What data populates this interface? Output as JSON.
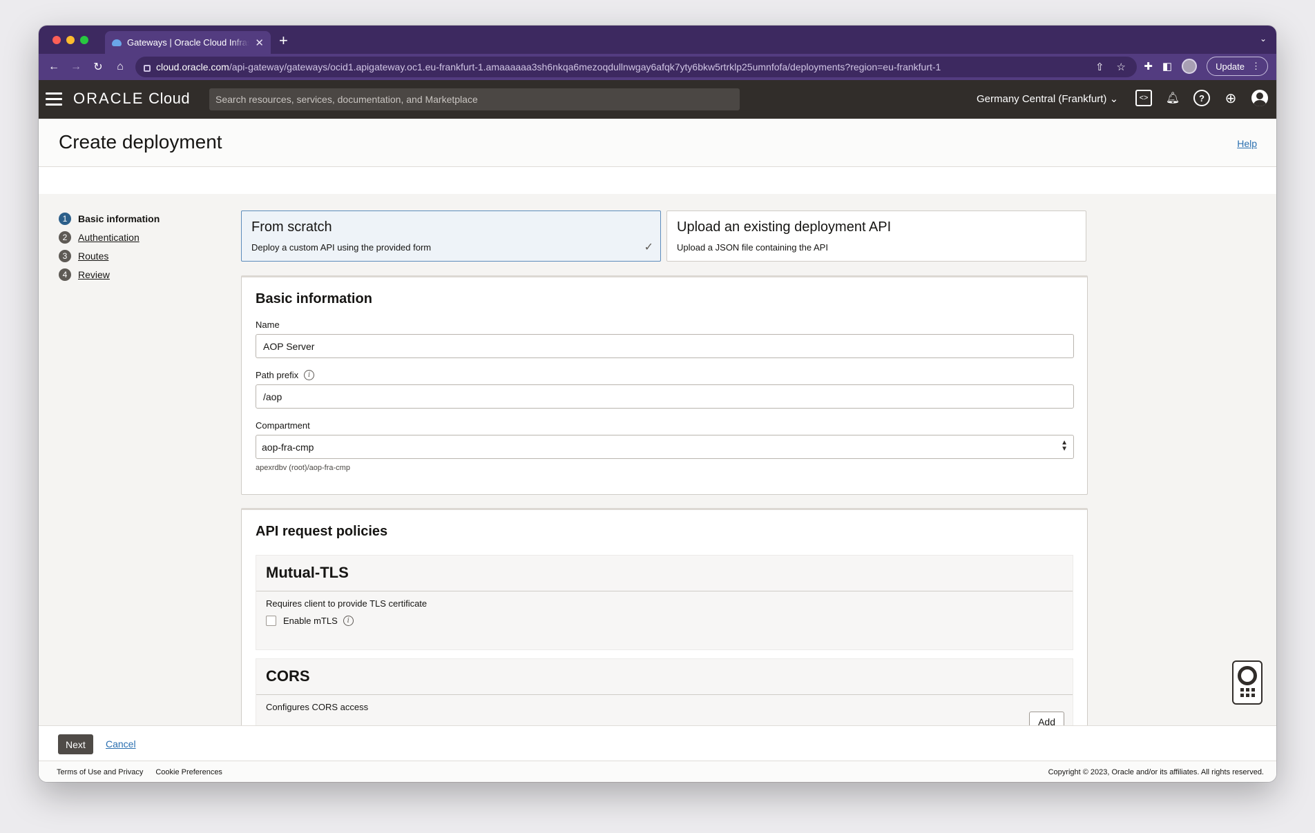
{
  "browser": {
    "tab_title": "Gateways | Oracle Cloud Infrastructure",
    "new_tab": "+",
    "url_host": "cloud.oracle.com",
    "url_path": "/api-gateway/gateways/ocid1.apigateway.oc1.eu-frankfurt-1.amaaaaaa3sh6nkqa6mezoqdullnwgay6afqk7yty6bkw5rtrklp25umnfofa/deployments?region=eu-frankfurt-1",
    "update_label": "Update"
  },
  "header": {
    "logo_brand": "ORACLE",
    "logo_product": "Cloud",
    "search_placeholder": "Search resources, services, documentation, and Marketplace",
    "region": "Germany Central (Frankfurt)"
  },
  "page": {
    "title": "Create deployment",
    "help": "Help"
  },
  "steps": [
    {
      "num": "1",
      "label": "Basic information"
    },
    {
      "num": "2",
      "label": "Authentication"
    },
    {
      "num": "3",
      "label": "Routes"
    },
    {
      "num": "4",
      "label": "Review"
    }
  ],
  "cards": {
    "scratch_title": "From scratch",
    "scratch_desc": "Deploy a custom API using the provided form",
    "upload_title": "Upload an existing deployment API",
    "upload_desc": "Upload a JSON file containing the API"
  },
  "basic": {
    "title": "Basic information",
    "name_label": "Name",
    "name_value": "AOP Server",
    "path_label": "Path prefix",
    "path_value": "/aop",
    "compartment_label": "Compartment",
    "compartment_value": "aop-fra-cmp",
    "compartment_path": "apexrdbv (root)/aop-fra-cmp"
  },
  "policies": {
    "title": "API request policies",
    "mtls_title": "Mutual-TLS",
    "mtls_desc": "Requires client to provide TLS certificate",
    "mtls_checkbox": "Enable mTLS",
    "cors_title": "CORS",
    "cors_desc": "Configures CORS access",
    "add_label": "Add"
  },
  "footer": {
    "next": "Next",
    "cancel": "Cancel",
    "terms": "Terms of Use and Privacy",
    "cookies": "Cookie Preferences",
    "copyright": "Copyright © 2023, Oracle and/or its affiliates. All rights reserved."
  }
}
